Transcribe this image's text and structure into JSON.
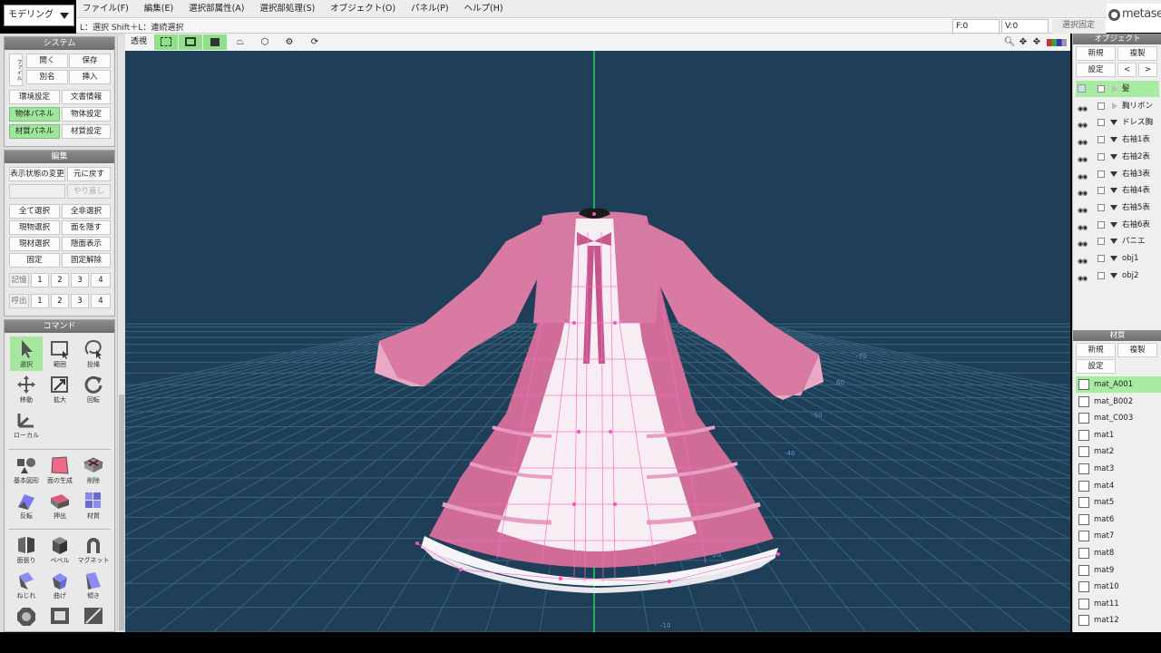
{
  "mode": "モデリング",
  "menu": [
    "ファイル(F)",
    "編集(E)",
    "選択部属性(A)",
    "選択部処理(S)",
    "オブジェクト(O)",
    "パネル(P)",
    "ヘルプ(H)"
  ],
  "status": {
    "text": "L：選択  Shift＋L：連続選択",
    "f": "F:0",
    "v": "V:0",
    "fix": "選択固定"
  },
  "logo": "metase",
  "system": {
    "title": "システム",
    "file_tab": "ファイル",
    "open": "開く",
    "save": "保存",
    "save_as": "別名",
    "insert": "挿入",
    "env": "環境設定",
    "doc": "文書情報",
    "obj_panel": "物体パネル",
    "obj_settings": "物体設定",
    "mat_panel": "材質パネル",
    "mat_settings": "材質設定"
  },
  "edit": {
    "title": "編集",
    "view_change": "表示状態の変更",
    "undo": "元に戻す",
    "redo": "やり直し",
    "select_all": "全て選択",
    "deselect_all": "全非選択",
    "obj_select": "現物選択",
    "hide_face": "面を隠す",
    "mat_select": "現材選択",
    "show_hidden": "隠面表示",
    "fix": "固定",
    "unfix": "固定解除",
    "memory": "記憶",
    "recall": "呼出",
    "slots": [
      "1",
      "2",
      "3",
      "4"
    ]
  },
  "command": {
    "title": "コマンド",
    "tools": [
      "選択",
      "範囲",
      "投縄",
      "移動",
      "拡大",
      "回転",
      "ローカル"
    ],
    "shapes": [
      "基本図形",
      "面の生成",
      "削除",
      "反転",
      "押出",
      "材質",
      "面張り",
      "ベベル",
      "マグネット",
      "ねじれ",
      "曲げ",
      "傾き"
    ]
  },
  "toolbar": {
    "view_label": "透視"
  },
  "objects": {
    "title": "オブジェクト",
    "new": "新規",
    "copy": "複製",
    "settings": "設定",
    "prev": "<",
    "next": ">",
    "items": [
      "髪",
      "胸リボン",
      "ドレス胸",
      "右袖1表",
      "右袖2表",
      "右袖3表",
      "右袖4表",
      "右袖5表",
      "右袖6表",
      "パニエ",
      "obj1",
      "obj2"
    ]
  },
  "materials": {
    "title": "材質",
    "new": "新規",
    "copy": "複製",
    "settings": "設定",
    "items": [
      "mat_A001",
      "mat_B002",
      "mat_C003",
      "mat1",
      "mat2",
      "mat3",
      "mat4",
      "mat5",
      "mat6",
      "mat7",
      "mat8",
      "mat9",
      "mat10",
      "mat11",
      "mat12"
    ]
  },
  "grid_labels": [
    "-70",
    "60",
    "-50",
    "-40",
    "-20",
    "-10"
  ],
  "colors": {
    "viewport_bg": "#1f3f59",
    "selected": "#a7eca2",
    "dress_pink": "#d9709e",
    "wire": "#ff66c8"
  }
}
